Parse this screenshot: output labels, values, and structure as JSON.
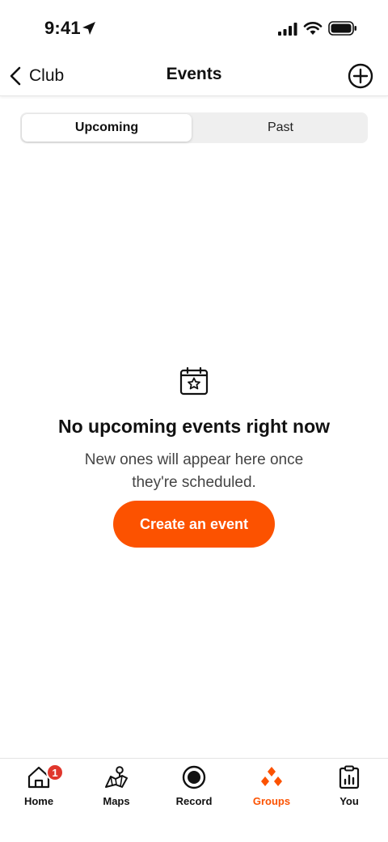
{
  "status_bar": {
    "time": "9:41"
  },
  "header": {
    "back_label": "Club",
    "title": "Events"
  },
  "segmented": {
    "tabs": [
      {
        "label": "Upcoming",
        "selected": true
      },
      {
        "label": "Past",
        "selected": false
      }
    ]
  },
  "empty_state": {
    "title": "No upcoming events right now",
    "subtitle": "New ones will appear here once they're scheduled.",
    "button_label": "Create an event"
  },
  "tabbar": {
    "items": [
      {
        "label": "Home",
        "badge": "1"
      },
      {
        "label": "Maps"
      },
      {
        "label": "Record"
      },
      {
        "label": "Groups",
        "active": true
      },
      {
        "label": "You"
      }
    ]
  },
  "colors": {
    "accent": "#fc5200",
    "badge": "#e0362c"
  }
}
